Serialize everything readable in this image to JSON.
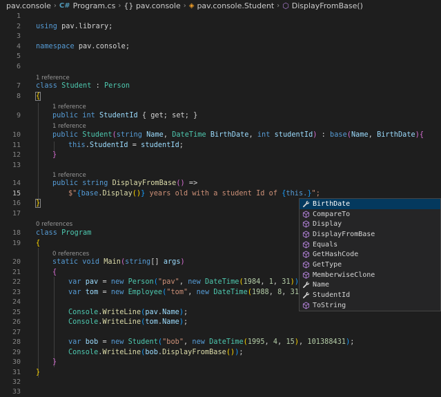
{
  "breadcrumb": {
    "items": [
      "pav.console",
      "Program.cs",
      "{} pav.console",
      "pav.console.Student",
      "DisplayFromBase()"
    ]
  },
  "code_lens": {
    "l7": "1 reference",
    "l9": "1 reference",
    "l10": "1 reference",
    "l14": "1 reference",
    "l18": "0 references",
    "l20": "0 references"
  },
  "line_numbers": [
    "1",
    "2",
    "3",
    "4",
    "5",
    "6",
    "7",
    "8",
    "9",
    "10",
    "11",
    "12",
    "13",
    "14",
    "15",
    "16",
    "17",
    "18",
    "19",
    "20",
    "21",
    "22",
    "23",
    "24",
    "25",
    "26",
    "27",
    "28",
    "29",
    "30",
    "31",
    "32",
    "33"
  ],
  "tokens": {
    "using": "using",
    "pav_library": "pav.library",
    "namespace": "namespace",
    "pav_console": "pav.console",
    "class": "class",
    "Student": "Student",
    "colon": " : ",
    "Person": "Person",
    "public": "public",
    "int": "int",
    "StudentId": "StudentId",
    "getset": " { get; set; }",
    "string": "string",
    "Name": "Name",
    "DateTime": "DateTime",
    "BirthDate": "BirthDate",
    "studentId": "studentId",
    "base": "base",
    "this": "this",
    "DisplayFromBase": "DisplayFromBase",
    "arrow": " =>",
    "interp_start": "$\"",
    "Display": "Display",
    "interp_text": " years old with a student Id of ",
    "this_dot": "this.",
    "interp_end": "\";",
    "Program": "Program",
    "static": "static",
    "void": "void",
    "Main": "Main",
    "args": "args",
    "var": "var",
    "pav": "pav",
    "tom": "tom",
    "bob": "bob",
    "new": "new",
    "Employee": "Employee",
    "Console": "Console",
    "WriteLine": "WriteLine",
    "s_pav": "\"pav\"",
    "s_tom": "\"tom\"",
    "s_bob": "\"bob\"",
    "n1984": "1984",
    "n1988": "1988",
    "n1995": "1995",
    "n1": "1",
    "n4": "4",
    "n8": "8",
    "n15": "15",
    "n31": "31",
    "n101388431": "101388431"
  },
  "suggestions": {
    "selected_index": 0,
    "items": [
      {
        "label": "BirthDate",
        "icon": "wrench-icon"
      },
      {
        "label": "CompareTo",
        "icon": "cube-icon"
      },
      {
        "label": "Display",
        "icon": "cube-icon"
      },
      {
        "label": "DisplayFromBase",
        "icon": "cube-icon"
      },
      {
        "label": "Equals",
        "icon": "cube-icon"
      },
      {
        "label": "GetHashCode",
        "icon": "cube-icon"
      },
      {
        "label": "GetType",
        "icon": "cube-icon"
      },
      {
        "label": "MemberwiseClone",
        "icon": "cube-icon"
      },
      {
        "label": "Name",
        "icon": "wrench-icon"
      },
      {
        "label": "StudentId",
        "icon": "wrench-icon"
      },
      {
        "label": "ToString",
        "icon": "cube-icon"
      }
    ]
  },
  "colors": {
    "background": "#1e1e1e",
    "keyword": "#569cd6",
    "type": "#4ec9b0",
    "function": "#dcdcaa",
    "string": "#ce9178",
    "number": "#b5cea8",
    "variable": "#9cdcfe",
    "suggest_bg": "#252526",
    "suggest_selected": "#04395e",
    "method_icon": "#b180d7"
  }
}
